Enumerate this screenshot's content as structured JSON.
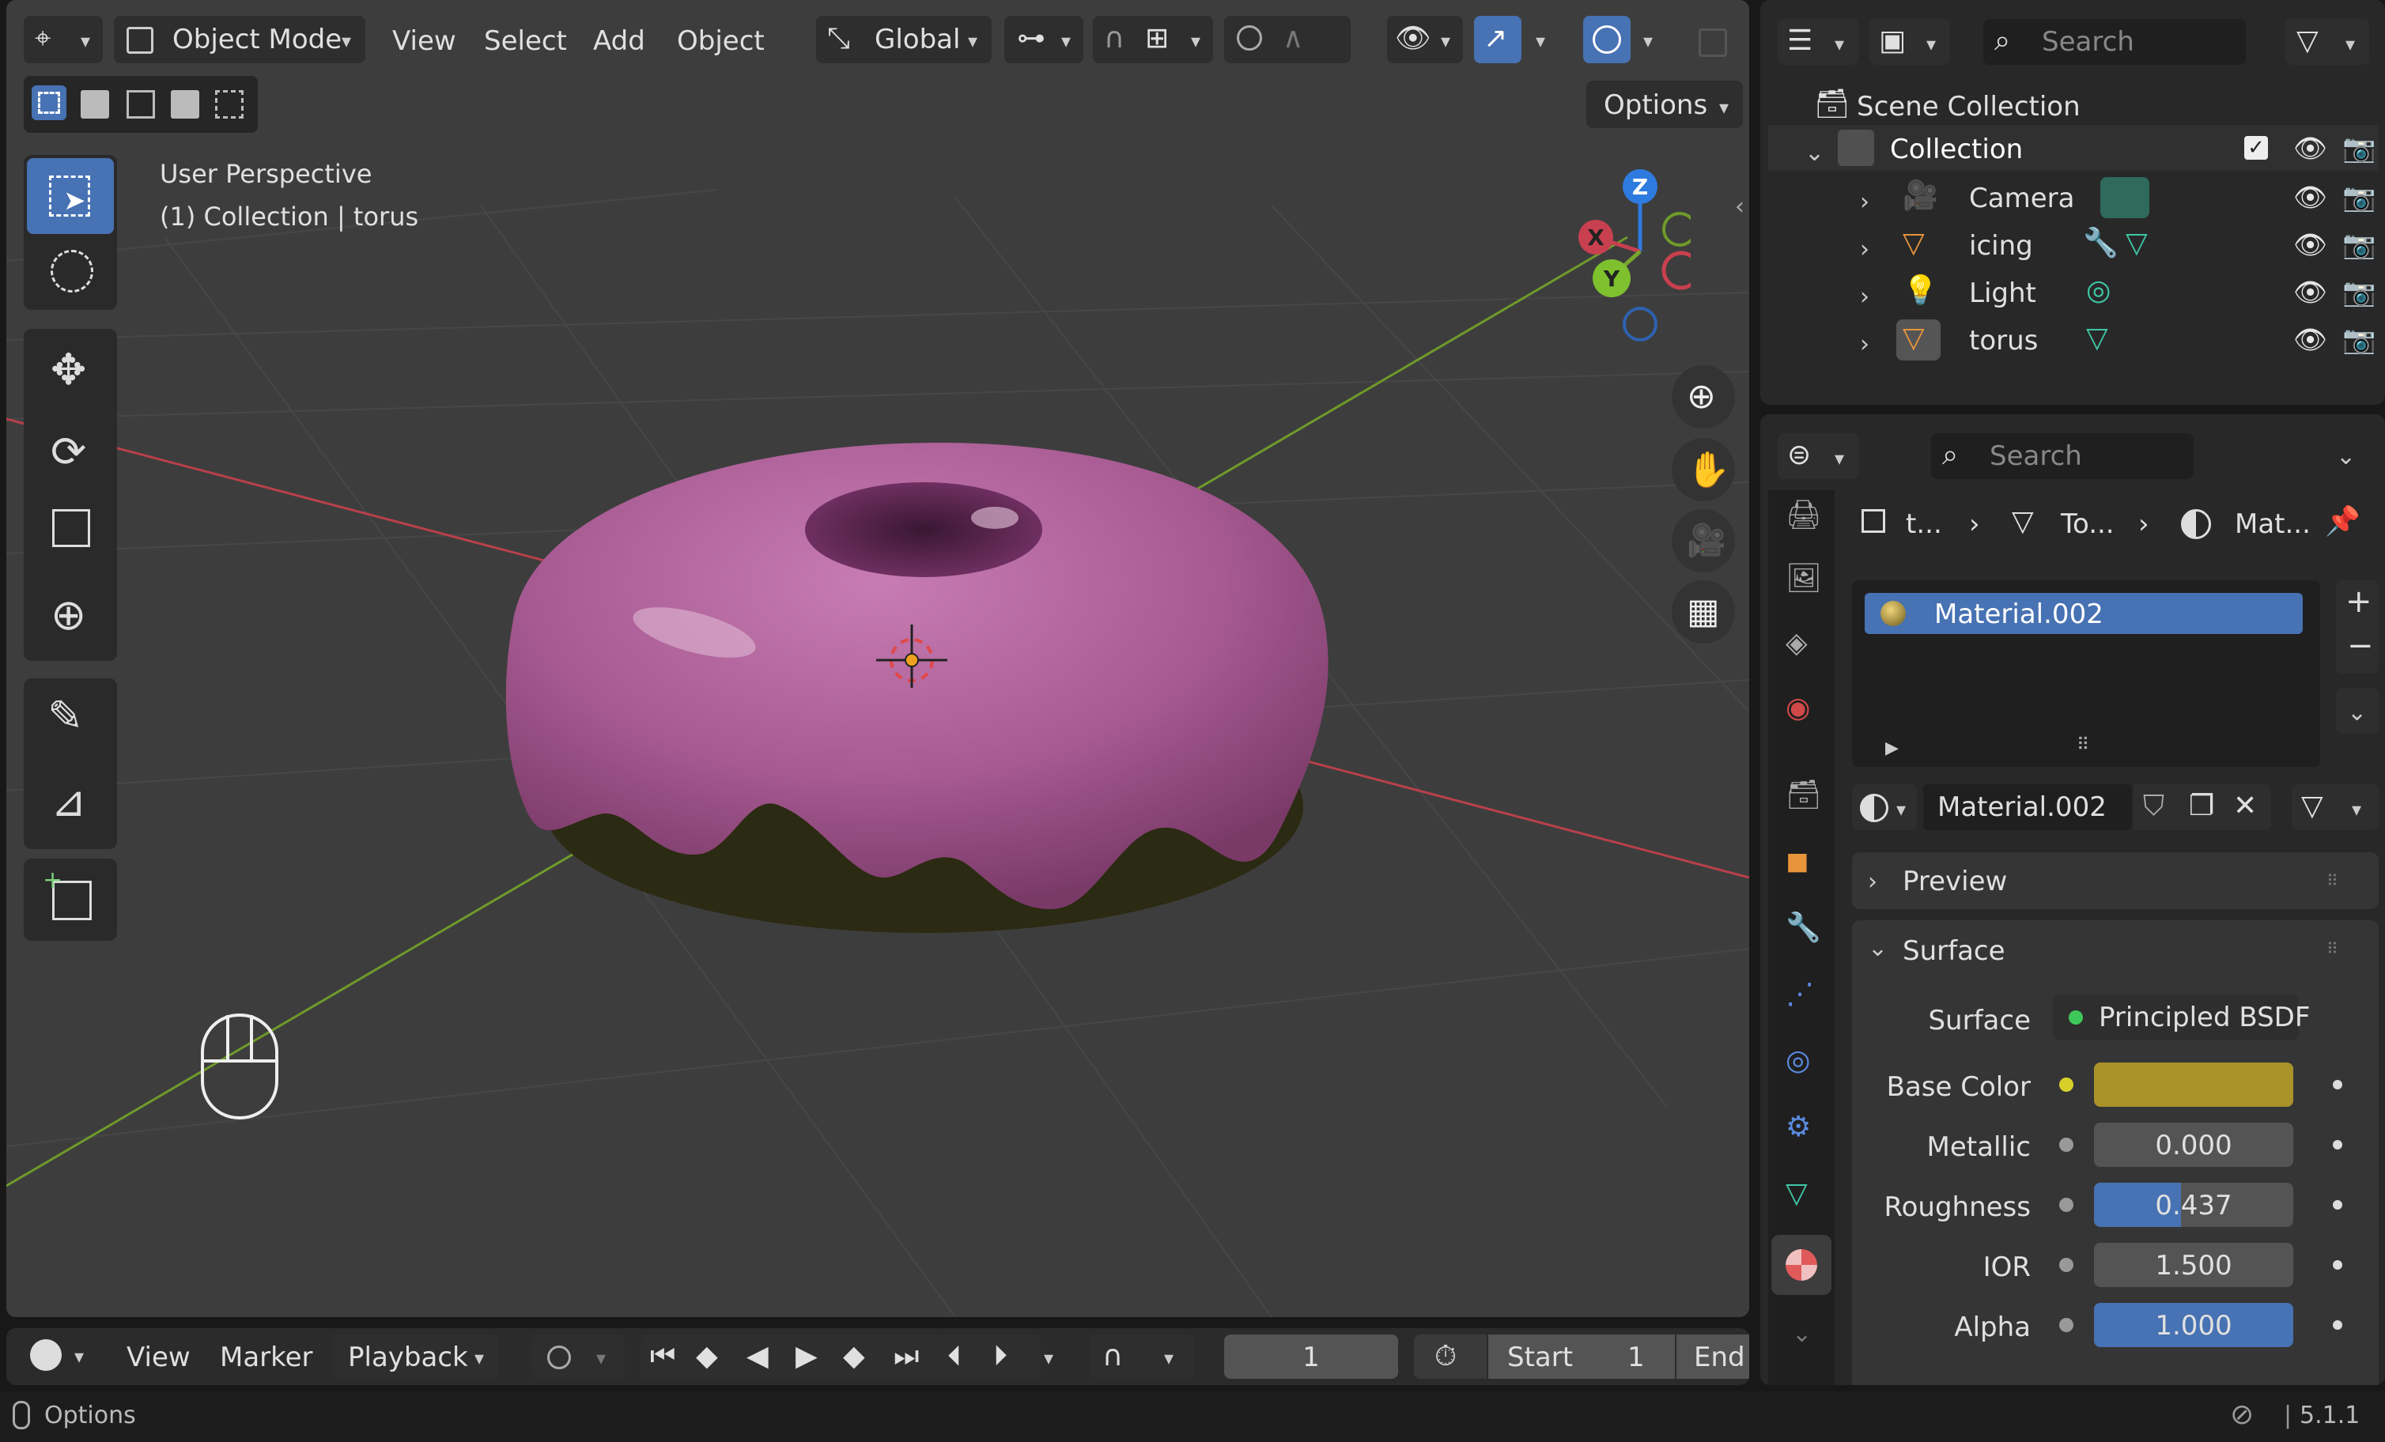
{
  "viewport": {
    "mode_label": "Object Mode",
    "menus": [
      "View",
      "Select",
      "Add",
      "Object"
    ],
    "orientation_label": "Global",
    "options_label": "Options",
    "info_line1": "User Perspective",
    "info_line2": "(1) Collection | torus",
    "gizmo_axes": {
      "x": "X",
      "y": "Y",
      "z": "Z"
    }
  },
  "timeline": {
    "menus": [
      "View",
      "Marker",
      "Playback"
    ],
    "current_frame": "1",
    "start_label": "Start",
    "start_value": "1",
    "end_label": "End"
  },
  "outliner": {
    "search_placeholder": "Search",
    "scene_collection": "Scene Collection",
    "collection": "Collection",
    "items": [
      {
        "name": "Camera"
      },
      {
        "name": "icing"
      },
      {
        "name": "Light"
      },
      {
        "name": "torus"
      }
    ]
  },
  "properties": {
    "search_placeholder": "Search",
    "breadcrumb": [
      "t...",
      "To...",
      "Mat..."
    ],
    "material_slot": "Material.002",
    "material_name": "Material.002",
    "preview_label": "Preview",
    "surface_panel_label": "Surface",
    "surface_label": "Surface",
    "surface_shader": "Principled BSDF",
    "fields": [
      {
        "label": "Base Color",
        "value": "",
        "fill": 1.0,
        "color": "#a99228"
      },
      {
        "label": "Metallic",
        "value": "0.000",
        "fill": 0.0
      },
      {
        "label": "Roughness",
        "value": "0.437",
        "fill": 0.437
      },
      {
        "label": "IOR",
        "value": "1.500",
        "fill": 0.0
      },
      {
        "label": "Alpha",
        "value": "1.000",
        "fill": 1.0
      }
    ]
  },
  "status": {
    "left_label": "Options",
    "version": "5.1.1"
  },
  "colors": {
    "accent": "#4772b3",
    "donut_icing": "#a65a91",
    "donut_base": "#2b2a12",
    "axis_x": "#c8404f",
    "axis_y": "#7aa52e",
    "axis_z": "#2e7be0",
    "base_color": "#a99228"
  }
}
